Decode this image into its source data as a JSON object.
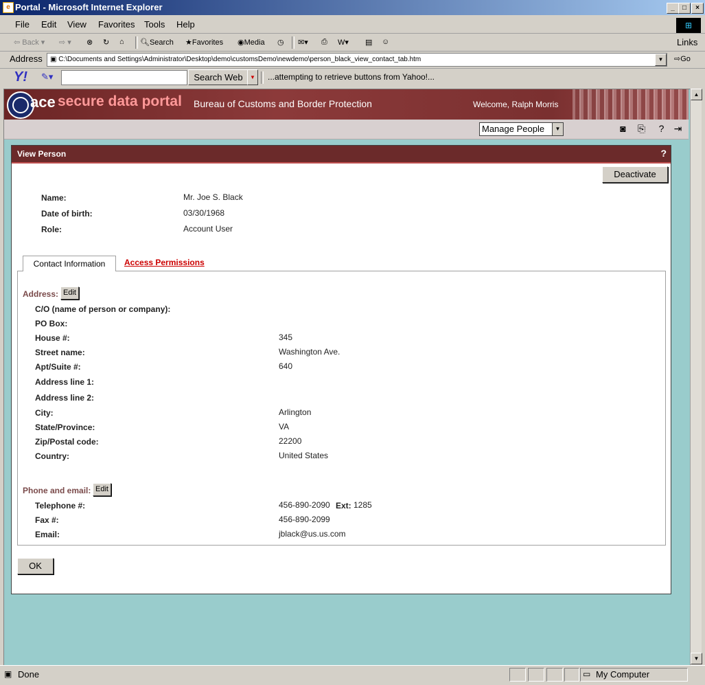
{
  "window": {
    "title": "Portal - Microsoft Internet Explorer",
    "controls": {
      "minimize": "_",
      "maximize": "□",
      "close": "×"
    }
  },
  "menu": [
    "File",
    "Edit",
    "View",
    "Favorites",
    "Tools",
    "Help"
  ],
  "toolbar": {
    "back": "Back",
    "search": "Search",
    "favorites": "Favorites",
    "media": "Media"
  },
  "address": {
    "label": "Address",
    "url": "C:\\Documents and Settings\\Administrator\\Desktop\\demo\\customsDemo\\newdemo\\person_black_view_contact_tab.htm",
    "go": "Go",
    "links": "Links"
  },
  "yahoo": {
    "logo": "Y!",
    "search_value": "",
    "search_button": "Search Web",
    "status": "...attempting to retrieve buttons from Yahoo!..."
  },
  "portal": {
    "brand_ace": "ace",
    "brand_name": "secure data portal",
    "agency": "Bureau of Customs and Border Protection",
    "welcome": "Welcome, Ralph Morris",
    "nav_select": "Manage People"
  },
  "panel": {
    "title": "View Person",
    "help": "?",
    "deactivate": "Deactivate",
    "person": [
      {
        "label": "Name:",
        "value": "Mr. Joe S. Black"
      },
      {
        "label": "Date of birth:",
        "value": "03/30/1968"
      },
      {
        "label": "Role:",
        "value": "Account User"
      }
    ],
    "tabs": {
      "active": "Contact Information",
      "other": "Access Permissions"
    },
    "address_section": "Address:",
    "edit": "Edit",
    "address_fields": [
      {
        "label": "C/O (name of person or company):",
        "value": ""
      },
      {
        "label": "PO Box:",
        "value": ""
      },
      {
        "label": "House #:",
        "value": "345"
      },
      {
        "label": "Street name:",
        "value": "Washington Ave."
      },
      {
        "label": "Apt/Suite #:",
        "value": "640"
      },
      {
        "label": "Address line 1:",
        "value": ""
      },
      {
        "label": "Address line 2:",
        "value": ""
      },
      {
        "label": "City:",
        "value": "Arlington"
      },
      {
        "label": "State/Province:",
        "value": "VA"
      },
      {
        "label": "Zip/Postal code:",
        "value": "22200"
      },
      {
        "label": "Country:",
        "value": "United States"
      }
    ],
    "phone_section": "Phone and email:",
    "telephone_label": "Telephone #:",
    "telephone_value": "456-890-2090",
    "ext_label": "Ext:",
    "ext_value": "1285",
    "fax_label": "Fax #:",
    "fax_value": "456-890-2099",
    "email_label": "Email:",
    "email_value": "jblack@us.us.com",
    "ok": "OK"
  },
  "status": {
    "text": "Done",
    "zone": "My Computer"
  },
  "colors": {
    "banner": "#6b2a2a",
    "viewport_bg": "#99cccc",
    "tab_link": "#cc0000"
  }
}
